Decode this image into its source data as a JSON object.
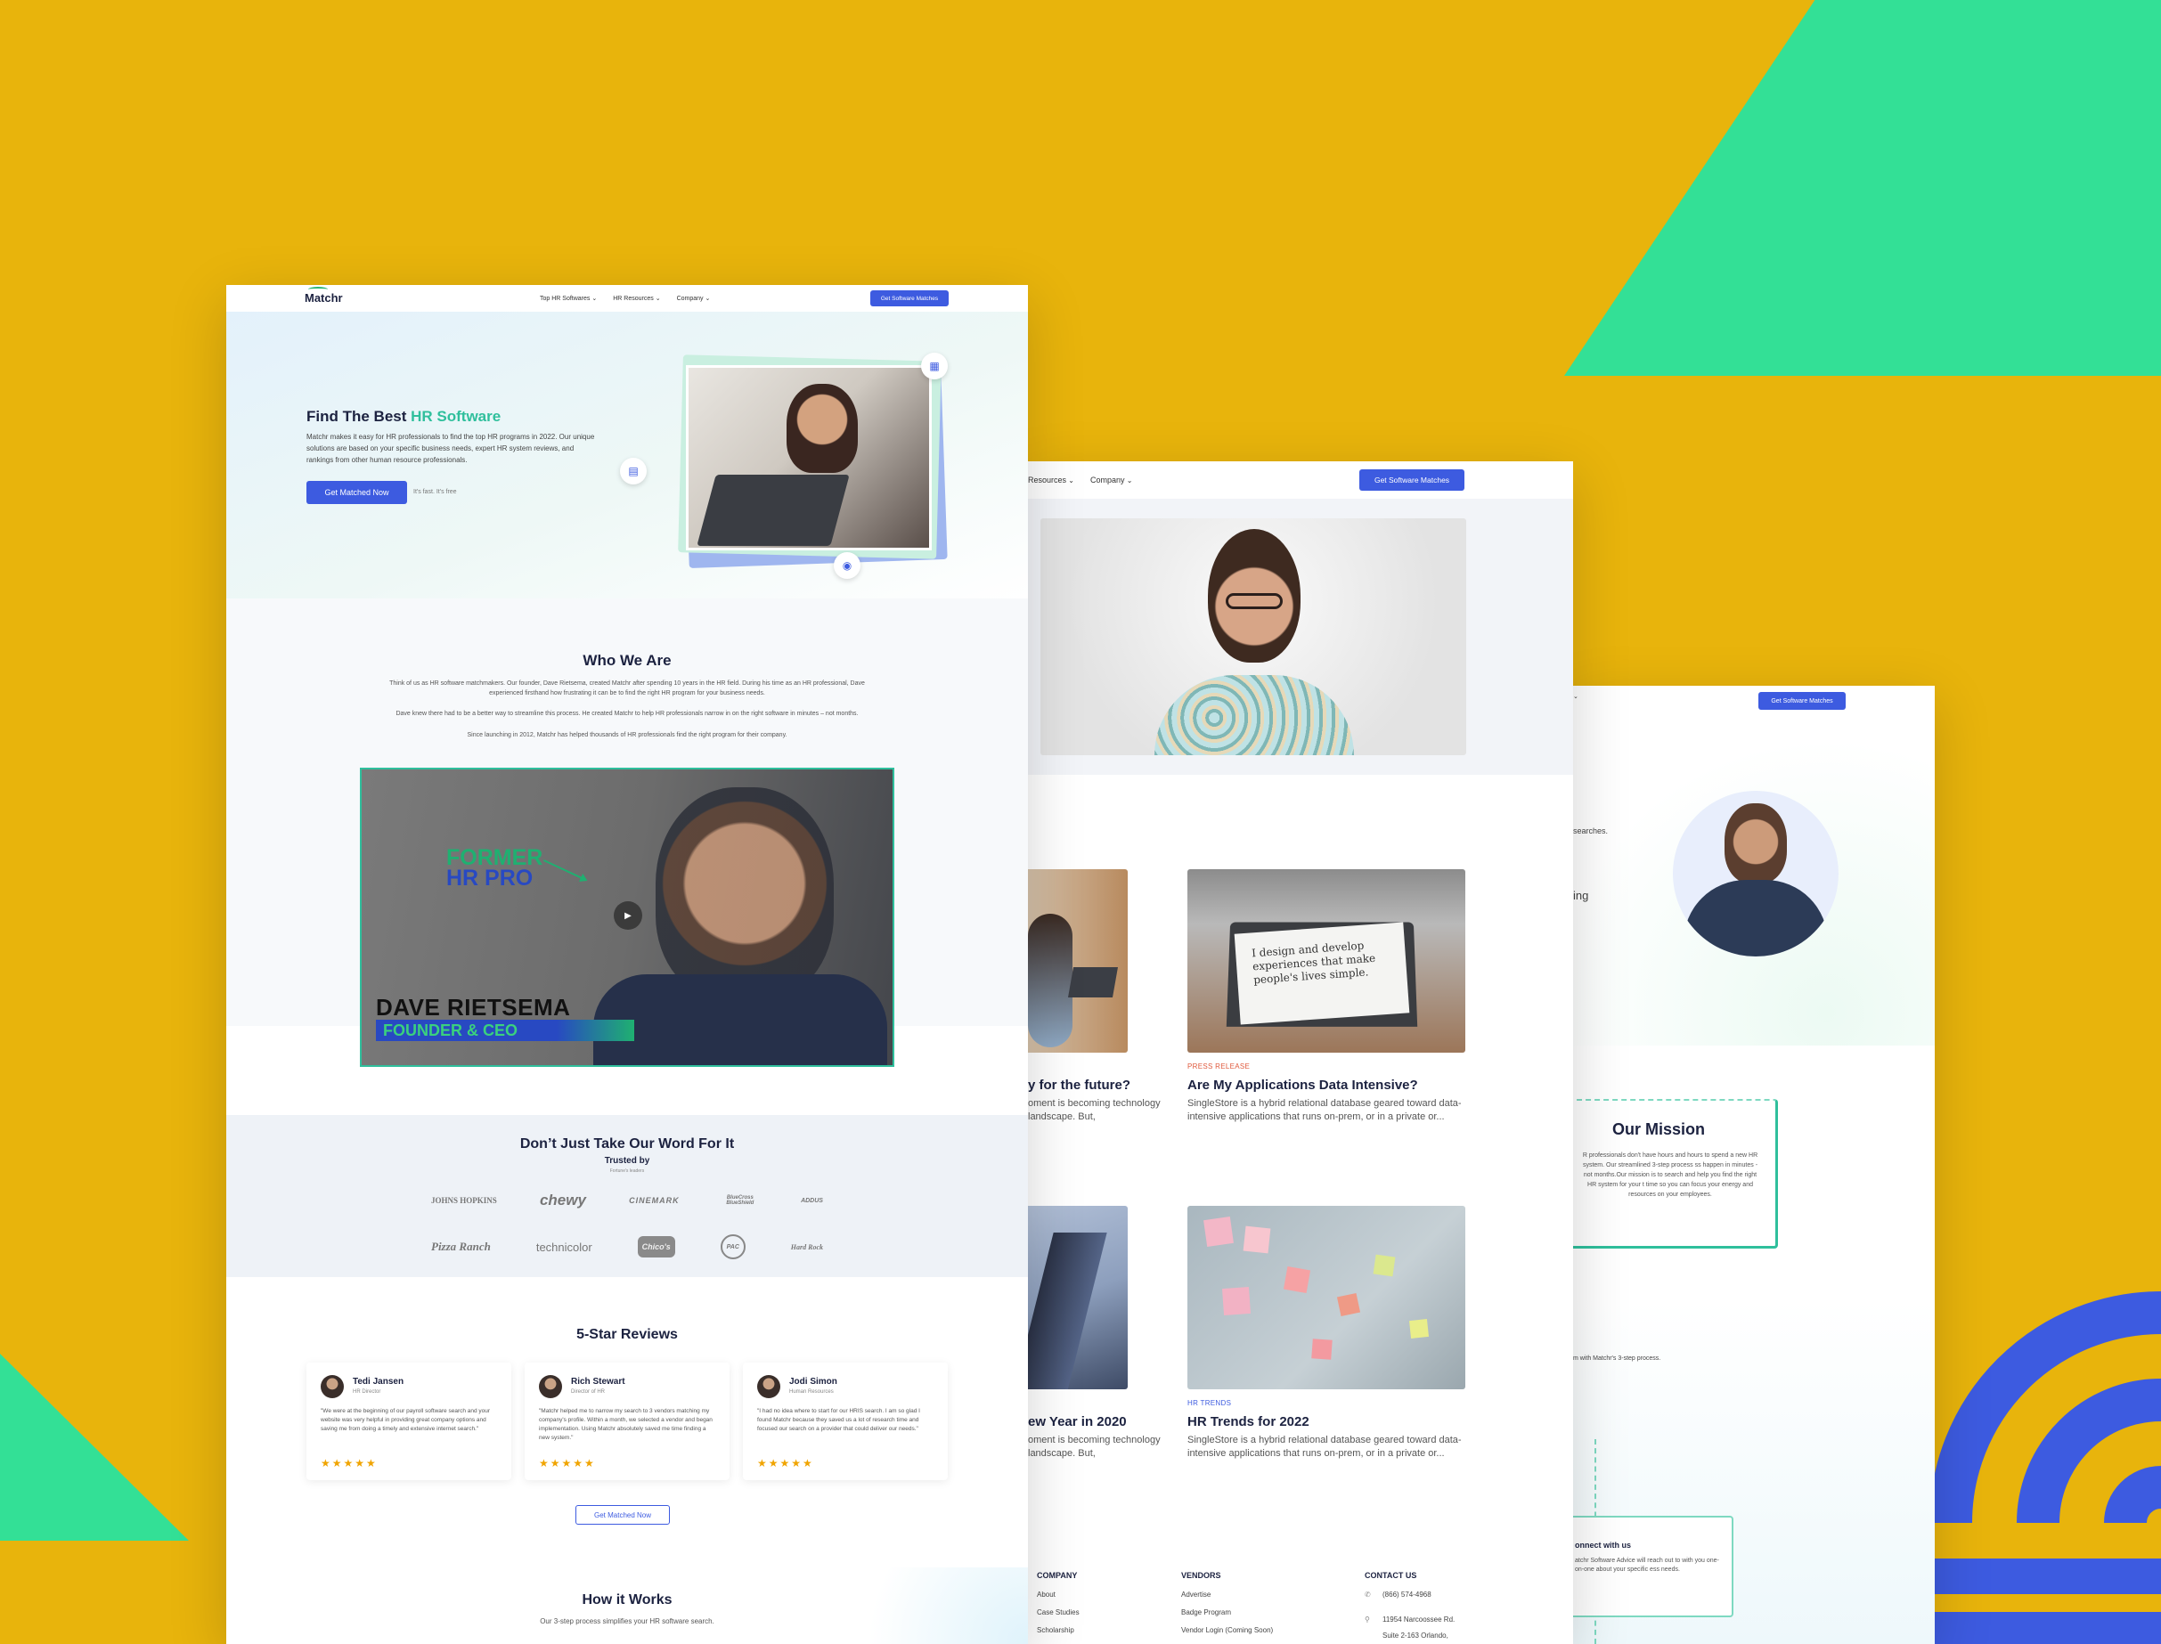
{
  "colors": {
    "background": "#E8B40C",
    "green": "#33E096",
    "blue": "#3d5be0",
    "accent": "#2fbf9c"
  },
  "page1": {
    "logo": "Matchr",
    "nav": [
      "Top HR Softwares",
      "HR Resources",
      "Company"
    ],
    "nav_button": "Get Software Matches",
    "hero": {
      "title_prefix": "Find The Best ",
      "title_accent": "HR Software",
      "lead": "Matchr makes it easy for HR professionals to find the top HR programs in 2022. Our unique solutions are based on your specific business needs, expert HR system reviews, and rankings from other human resource professionals.",
      "cta": "Get Matched Now",
      "cta_note": "It's fast. It's free"
    },
    "who": {
      "title": "Who We Are",
      "p1": "Think of us as HR software matchmakers. Our founder, Dave Rietsema, created Matchr after spending 10 years in the HR field. During his time as an HR professional, Dave experienced firsthand how frustrating it can be to find the right HR program for your business needs.",
      "p2": "Dave knew there had to be a better way to streamline this process. He created Matchr to help HR professionals narrow in on the right software in minutes – not months.",
      "p3": "Since launching in 2012, Matchr has helped thousands of HR professionals find the right program for their company."
    },
    "video": {
      "line1": "FORMER",
      "line2": "HR PRO",
      "name": "DAVE RIETSEMA",
      "role_a": "FOUNDER",
      "role_b": " & CEO"
    },
    "trusted": {
      "title": "Don’t Just Take Our Word For It",
      "sub": "Trusted by",
      "sub2": "Fortune's leaders",
      "row1": [
        "JOHNS HOPKINS",
        "chewy",
        "CINEMARK",
        "BlueCross BlueShield",
        "ADDUS"
      ],
      "row2": [
        "Pizza Ranch",
        "technicolor",
        "Chico's",
        "PAC",
        "Hard Rock"
      ]
    },
    "reviews": {
      "title": "5-Star Reviews",
      "items": [
        {
          "name": "Tedi Jansen",
          "role": "HR Director",
          "text": "\"We were at the beginning of our payroll software search and your website was very helpful in providing great company options and saving me from doing a timely and extensive internet search.\"",
          "stars": "★★★★★"
        },
        {
          "name": "Rich Stewart",
          "role": "Director of HR",
          "text": "\"Matchr helped me to narrow my search to 3 vendors matching my company's profile. Within a month, we selected a vendor and began implementation. Using Matchr absolutely saved me time finding a new system.\"",
          "stars": "★★★★★"
        },
        {
          "name": "Jodi Simon",
          "role": "Human Resources",
          "text": "\"I had no idea where to start for our HRIS search. I am so glad I found Matchr because they saved us a lot of research time and focused our search on a provider that could deliver our needs.\"",
          "stars": "★★★★★"
        }
      ],
      "button": "Get Matched Now"
    },
    "how": {
      "title": "How it Works",
      "sub": "Our 3-step process simplifies your HR software search."
    }
  },
  "page2": {
    "nav": [
      "Resources",
      "Company"
    ],
    "nav_button": "Get Software Matches",
    "posts": [
      {
        "tag": "",
        "title": "y for the future?",
        "excerpt": "oment is becoming technology landscape. But,"
      },
      {
        "tag": "PRESS RELEASE",
        "title": "Are My Applications Data Intensive?",
        "excerpt": "SingleStore is a hybrid relational database geared toward data-intensive applications that runs on-prem, or in a private or..."
      },
      {
        "tag": "",
        "title": "ew Year in 2020",
        "excerpt": "oment is becoming technology landscape. But,"
      },
      {
        "tag": "HR TRENDS",
        "title": "HR Trends for 2022",
        "excerpt": "SingleStore is a hybrid relational database geared toward data-intensive applications that runs on-prem, or in a private or..."
      }
    ],
    "laptop_text": "I design and develop experiences that make people's lives simple.",
    "footer": {
      "company": {
        "title": "COMPANY",
        "links": [
          "About",
          "Case Studies",
          "Scholarship"
        ]
      },
      "vendors": {
        "title": "VENDORS",
        "links": [
          "Advertise",
          "Badge Program",
          "Vendor Login (Coming Soon)"
        ]
      },
      "contact": {
        "title": "CONTACT US",
        "phone": "(866) 574-4968",
        "address1": "11954 Narcoossee Rd.",
        "address2": "Suite 2-163 Orlando,"
      }
    }
  },
  "page3": {
    "nav_button": "Get Software Matches",
    "snippet1": "searches.",
    "snippet2": "ing",
    "mission": {
      "title": "Our Mission",
      "text": "R professionals don't have hours and hours to spend a new HR system. Our streamlined 3-step process ss happen in minutes - not months.Our mission is to search and help you find the right HR system for your t time so you can focus your energy and resources on your employees."
    },
    "process_text": "m with Matchr's 3-step process.",
    "connect": {
      "title": "onnect with us",
      "text": "atchr Software Advice will reach out to with you one-on-one about your specific ess needs."
    }
  }
}
